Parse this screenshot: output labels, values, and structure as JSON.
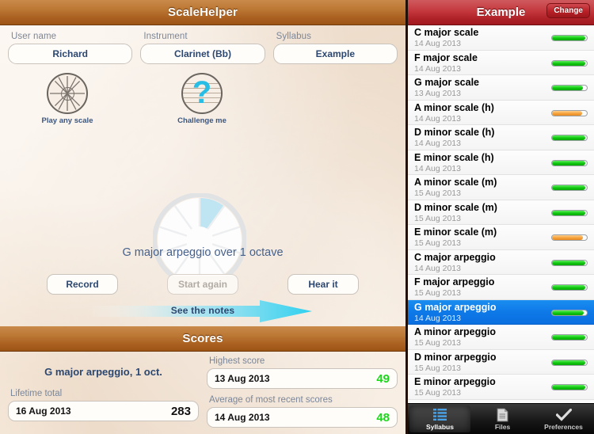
{
  "left": {
    "title": "ScaleHelper",
    "form": [
      {
        "label": "User name",
        "value": "Richard",
        "name": "user-name"
      },
      {
        "label": "Instrument",
        "value": "Clarinet (Bb)",
        "name": "instrument"
      },
      {
        "label": "Syllabus",
        "value": "Example",
        "name": "syllabus"
      }
    ],
    "mode_icons": [
      {
        "caption": "Play any scale",
        "icon": "wheel-icon"
      },
      {
        "caption": "Challenge me",
        "icon": "question-mark-icon"
      }
    ],
    "wheel": {
      "segments": 10,
      "highlighted_segment": 0,
      "caption": "G major arpeggio over 1 octave",
      "highlight_color": "#bfe4f2"
    },
    "buttons": [
      {
        "label": "Record",
        "enabled": true
      },
      {
        "label": "Start again",
        "enabled": false
      },
      {
        "label": "Hear it",
        "enabled": true
      }
    ],
    "arrow": {
      "label": "See the notes",
      "color": "#3ad2ee"
    },
    "scores": {
      "title": "Scores",
      "current_scale": "G major arpeggio, 1 oct.",
      "lifetime": {
        "label": "Lifetime total",
        "date": "16 Aug 2013",
        "value": "283"
      },
      "highest": {
        "label": "Highest score",
        "date": "13 Aug 2013",
        "value": "49"
      },
      "average": {
        "label": "Average of most recent scores",
        "date": "14 Aug 2013",
        "value": "48"
      }
    }
  },
  "right": {
    "title": "Example",
    "change_label": "Change",
    "items": [
      {
        "name": "C major scale",
        "date": "14 Aug 2013",
        "progress": 96,
        "status": "green",
        "selected": false
      },
      {
        "name": "F major scale",
        "date": "14 Aug 2013",
        "progress": 96,
        "status": "green",
        "selected": false
      },
      {
        "name": "G major scale",
        "date": "13 Aug 2013",
        "progress": 88,
        "status": "green",
        "selected": false
      },
      {
        "name": "A minor scale (h)",
        "date": "14 Aug 2013",
        "progress": 86,
        "status": "orange",
        "selected": false
      },
      {
        "name": "D minor scale (h)",
        "date": "14 Aug 2013",
        "progress": 96,
        "status": "green",
        "selected": false
      },
      {
        "name": "E minor scale (h)",
        "date": "14 Aug 2013",
        "progress": 96,
        "status": "green",
        "selected": false
      },
      {
        "name": "A minor scale (m)",
        "date": "15 Aug 2013",
        "progress": 96,
        "status": "green",
        "selected": false
      },
      {
        "name": "D minor scale (m)",
        "date": "15 Aug 2013",
        "progress": 96,
        "status": "green",
        "selected": false
      },
      {
        "name": "E minor scale (m)",
        "date": "15 Aug 2013",
        "progress": 88,
        "status": "orange",
        "selected": false
      },
      {
        "name": "C major arpeggio",
        "date": "14 Aug 2013",
        "progress": 96,
        "status": "green",
        "selected": false
      },
      {
        "name": "F major arpeggio",
        "date": "15 Aug 2013",
        "progress": 96,
        "status": "green",
        "selected": false
      },
      {
        "name": "G major arpeggio",
        "date": "14 Aug 2013",
        "progress": 92,
        "status": "green",
        "selected": true
      },
      {
        "name": "A minor arpeggio",
        "date": "15 Aug 2013",
        "progress": 96,
        "status": "green",
        "selected": false
      },
      {
        "name": "D minor arpeggio",
        "date": "15 Aug 2013",
        "progress": 96,
        "status": "green",
        "selected": false
      },
      {
        "name": "E minor arpeggio",
        "date": "15 Aug 2013",
        "progress": 96,
        "status": "green",
        "selected": false
      }
    ],
    "tabs": [
      {
        "label": "Syllabus",
        "icon": "list-icon",
        "active": true
      },
      {
        "label": "Files",
        "icon": "document-icon",
        "active": false
      },
      {
        "label": "Preferences",
        "icon": "checkmark-icon",
        "active": false
      }
    ]
  }
}
